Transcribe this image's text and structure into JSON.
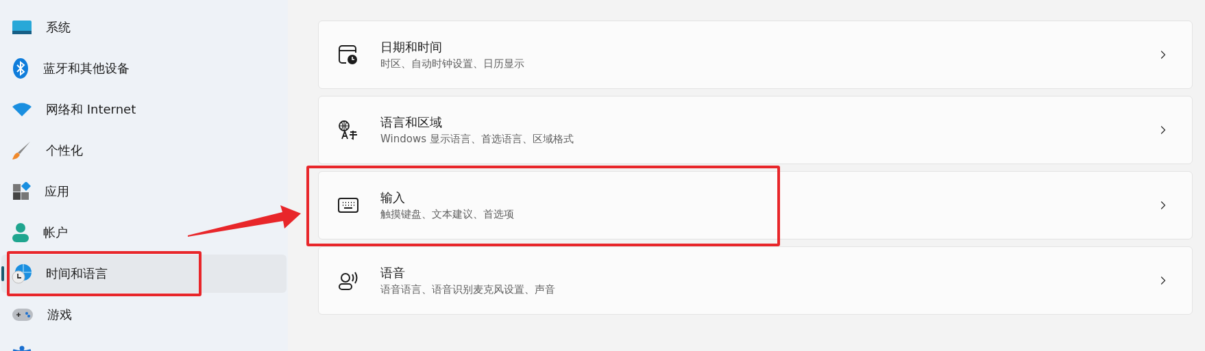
{
  "sidebar": {
    "items": [
      {
        "label": "系统",
        "selected": false,
        "highlighted": false
      },
      {
        "label": "蓝牙和其他设备",
        "selected": false,
        "highlighted": false
      },
      {
        "label": "网络和 Internet",
        "selected": false,
        "highlighted": false
      },
      {
        "label": "个性化",
        "selected": false,
        "highlighted": false
      },
      {
        "label": "应用",
        "selected": false,
        "highlighted": false
      },
      {
        "label": "帐户",
        "selected": false,
        "highlighted": false
      },
      {
        "label": "时间和语言",
        "selected": true,
        "highlighted": true
      },
      {
        "label": "游戏",
        "selected": false,
        "highlighted": false
      }
    ]
  },
  "settings": [
    {
      "title": "日期和时间",
      "subtitle": "时区、自动时钟设置、日历显示",
      "highlighted": false
    },
    {
      "title": "语言和区域",
      "subtitle": "Windows 显示语言、首选语言、区域格式",
      "highlighted": false
    },
    {
      "title": "输入",
      "subtitle": "触摸键盘、文本建议、首选项",
      "highlighted": true
    },
    {
      "title": "语音",
      "subtitle": "语音语言、语音识别麦克风设置、声音",
      "highlighted": false
    }
  ],
  "annotation_arrow": true
}
